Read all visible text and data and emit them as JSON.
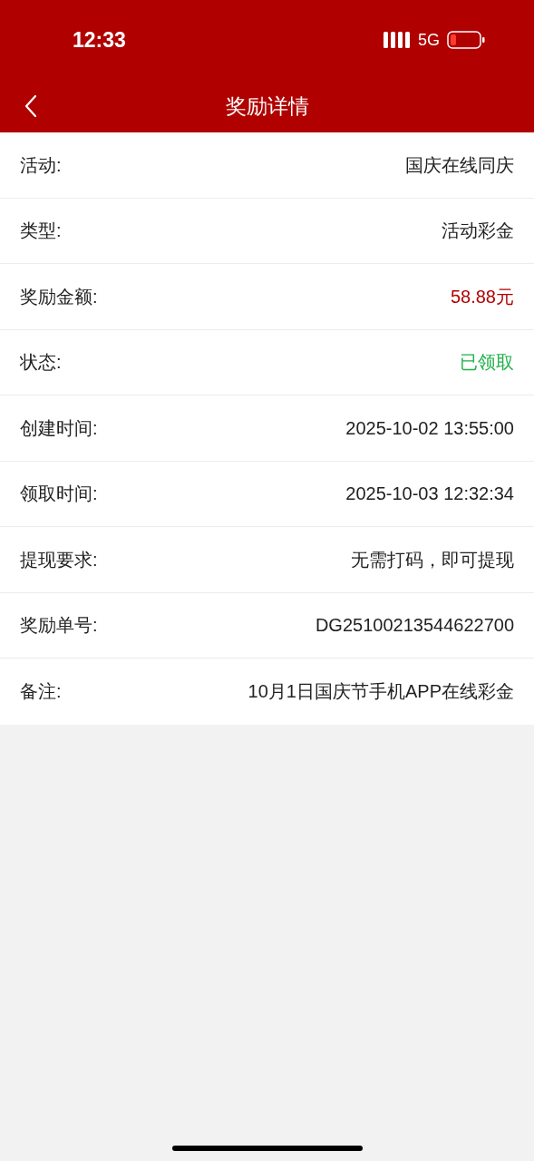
{
  "status_bar": {
    "time": "12:33",
    "network": "5G"
  },
  "nav": {
    "title": "奖励详情"
  },
  "rows": [
    {
      "label": "活动:",
      "value": "国庆在线同庆"
    },
    {
      "label": "类型:",
      "value": "活动彩金"
    },
    {
      "label": "奖励金额:",
      "value": "58.88元",
      "color": "#b30000"
    },
    {
      "label": "状态:",
      "value": "已领取",
      "color": "#22b14c"
    },
    {
      "label": "创建时间:",
      "value": "2025-10-02 13:55:00"
    },
    {
      "label": "领取时间:",
      "value": "2025-10-03 12:32:34"
    },
    {
      "label": "提现要求:",
      "value": "无需打码，即可提现"
    },
    {
      "label": "奖励单号:",
      "value": "DG25100213544622700"
    },
    {
      "label": "备注:",
      "value": "10月1日国庆节手机APP在线彩金"
    }
  ]
}
